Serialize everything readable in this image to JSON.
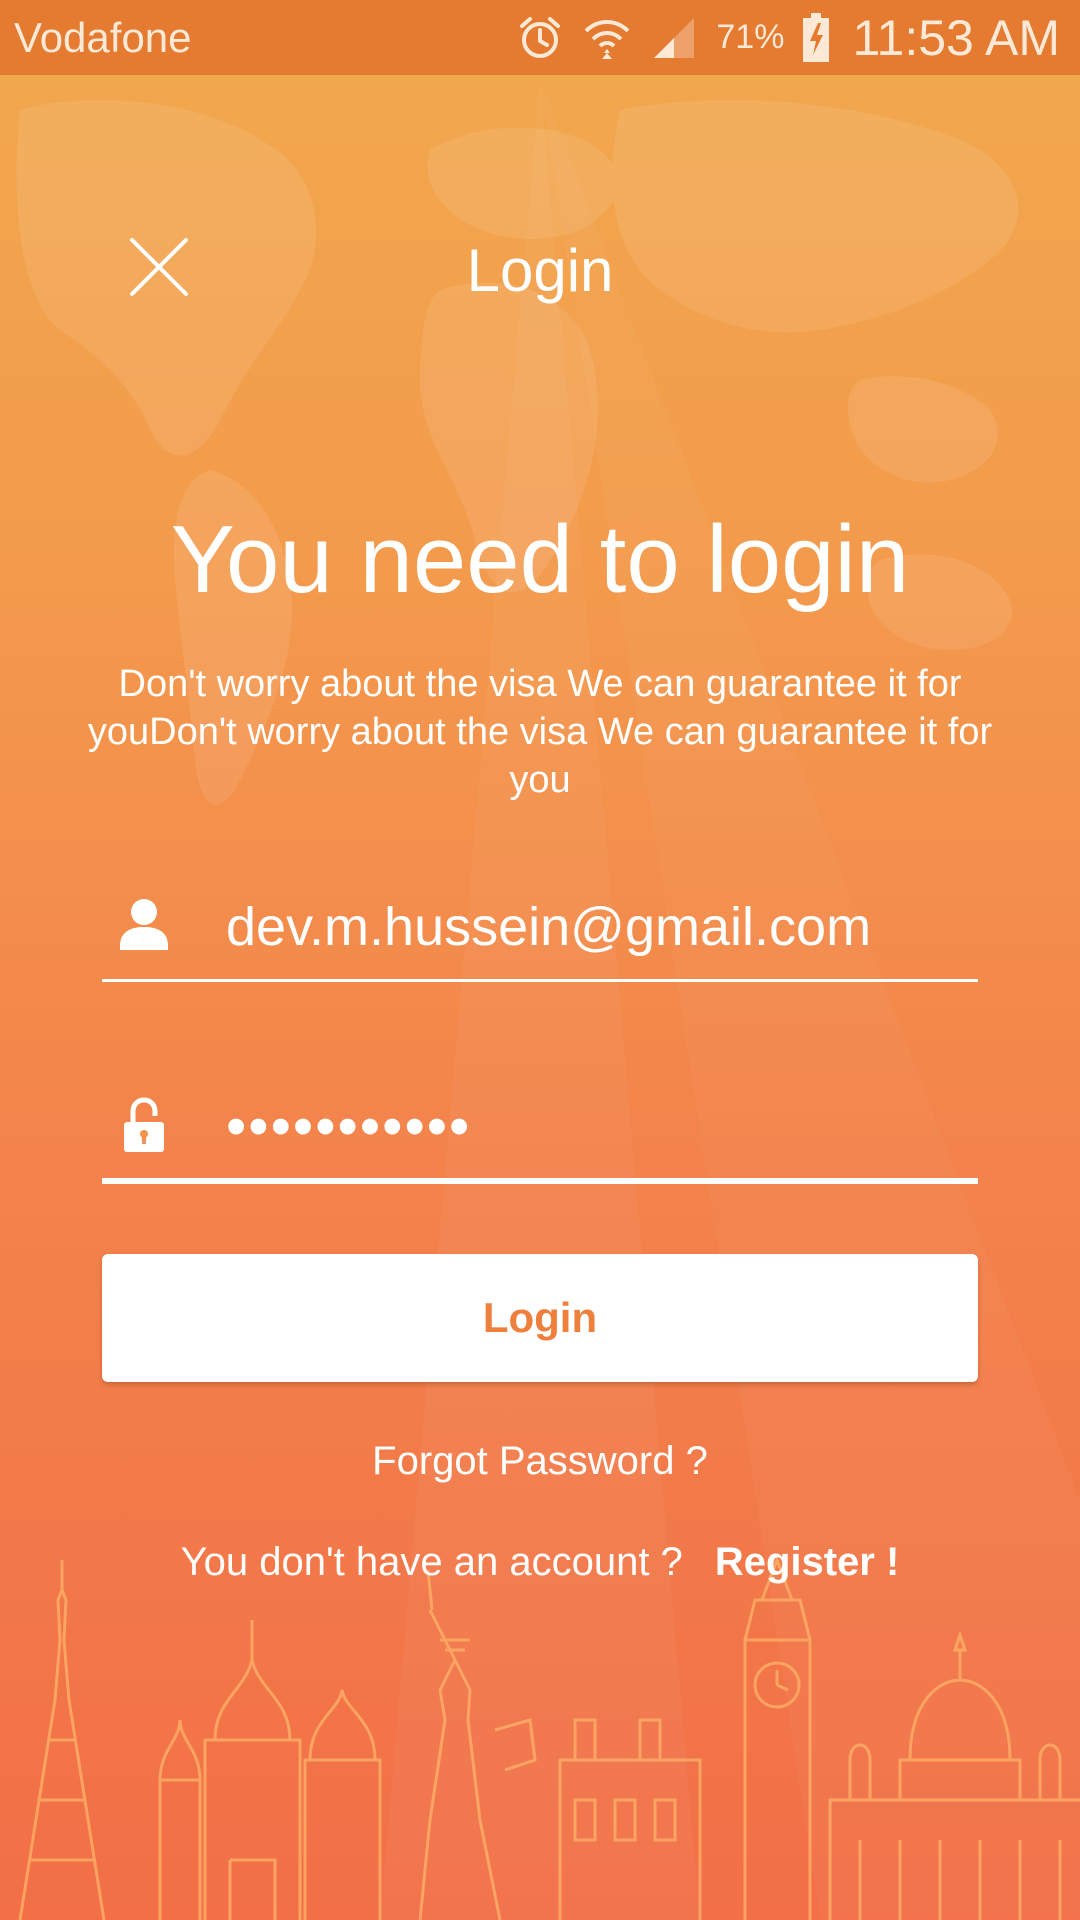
{
  "status_bar": {
    "carrier": "Vodafone",
    "battery_percent": "71%",
    "time": "11:53 AM"
  },
  "header": {
    "title": "Login"
  },
  "main": {
    "headline": "You need to login",
    "subtext": "Don't worry about the visa We can guarantee it for youDon't worry about the visa We can guarantee it for you"
  },
  "form": {
    "email_value": "dev.m.hussein@gmail.com",
    "password_value": "•••••••••••",
    "login_label": "Login",
    "forgot_label": "Forgot Password ?",
    "no_account_label": "You don't have an account ?",
    "register_label": "Register !"
  },
  "icons": {
    "close": "close-icon",
    "user": "user-icon",
    "lock": "lock-icon",
    "alarm": "alarm-icon",
    "wifi": "wifi-icon",
    "signal": "signal-icon",
    "battery": "battery-icon"
  },
  "colors": {
    "status_bar": "#e57a31",
    "background_top": "#f1a94d",
    "background_bottom": "#f26f47",
    "button_text": "#ee7f3c",
    "text": "#ffffff"
  }
}
